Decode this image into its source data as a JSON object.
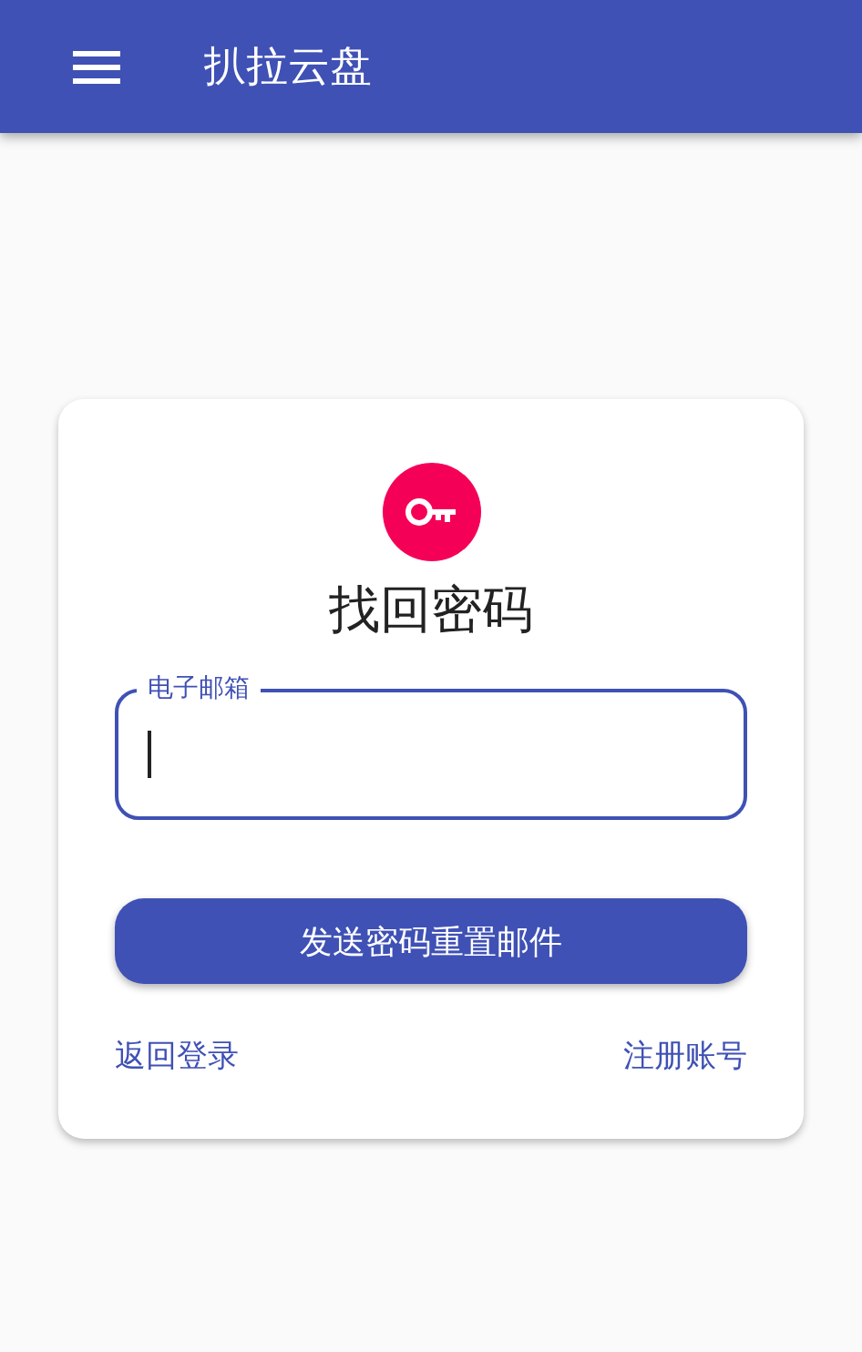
{
  "app_bar": {
    "title": "扒拉云盘"
  },
  "card": {
    "title": "找回密码",
    "email_field": {
      "label": "电子邮箱",
      "focused": true
    },
    "submit_button": "发送密码重置邮件",
    "links": [
      {
        "label": "返回登录"
      },
      {
        "label": "注册账号"
      }
    ]
  }
}
